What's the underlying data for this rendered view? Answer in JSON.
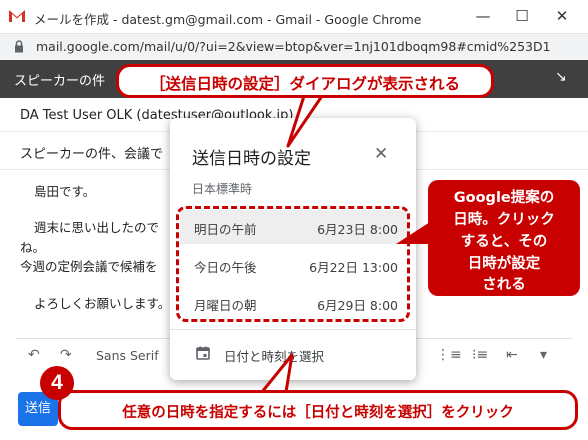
{
  "window": {
    "title": "メールを作成 - datest.gm@gmail.com - Gmail - Google Chrome",
    "minimize_label": "—",
    "maximize_label": "☐",
    "close_label": "✕"
  },
  "address_bar": {
    "url": "mail.google.com/mail/u/0/?ui=2&view=btop&ver=1nj101dboqm98#cmid%253D1"
  },
  "compose": {
    "header_title": "スピーカーの件",
    "expand_icon": "↘",
    "to": "DA Test User OLK (datestuser@outlook.jp)",
    "subject": "スピーカーの件、会議で",
    "body_lines": [
      "島田です。",
      "週末に思い出したので",
      "ね。",
      "今週の定例会議で候補を",
      "よろしくお願いします。"
    ],
    "toolbar": {
      "undo": "↶",
      "redo": "↷",
      "font": "Sans Serif",
      "numbered_list": "⋮≡",
      "bulleted_list": "⁝≡",
      "indent_less": "⇤",
      "more": "▾"
    },
    "send_label": "送信"
  },
  "dialog": {
    "title": "送信日時の設定",
    "close_icon": "✕",
    "timezone": "日本標準時",
    "options": [
      {
        "label": "明日の午前",
        "time": "6月23日 8:00"
      },
      {
        "label": "今日の午後",
        "time": "6月22日 13:00"
      },
      {
        "label": "月曜日の朝",
        "time": "6月29日 8:00"
      }
    ],
    "pick_label": "日付と時刻を選択"
  },
  "callouts": {
    "top": "［送信日時の設定］ダイアログが表示される",
    "right_lines": [
      "Google提案の",
      "日時。クリック",
      "すると、その",
      "日時が設定",
      "される"
    ],
    "bottom": "任意の日時を指定するには［日付と時刻を選択］をクリック",
    "step_number": "4"
  },
  "colors": {
    "accent_red": "#c80000",
    "compose_header": "#404040",
    "send_blue": "#1a73e8"
  }
}
